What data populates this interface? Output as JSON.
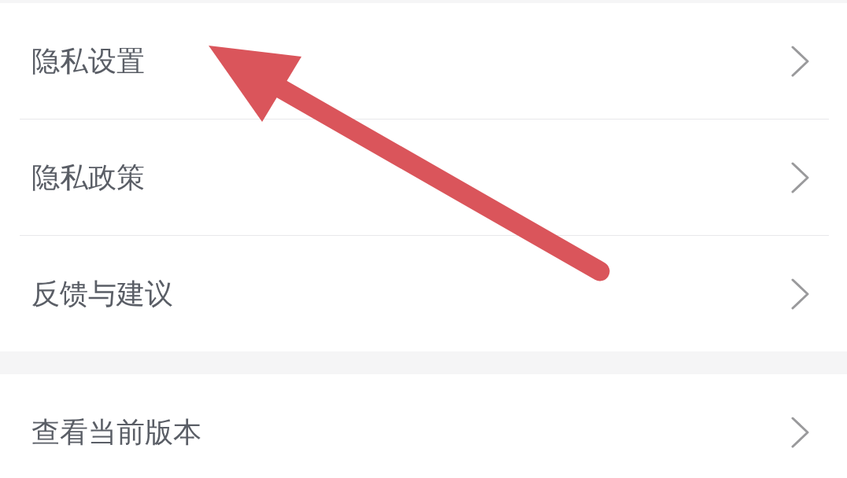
{
  "sections": [
    {
      "items": [
        {
          "label": "隐私设置"
        },
        {
          "label": "隐私政策"
        },
        {
          "label": "反馈与建议"
        }
      ]
    },
    {
      "items": [
        {
          "label": "查看当前版本"
        }
      ]
    }
  ],
  "annotation": {
    "kind": "arrow"
  }
}
